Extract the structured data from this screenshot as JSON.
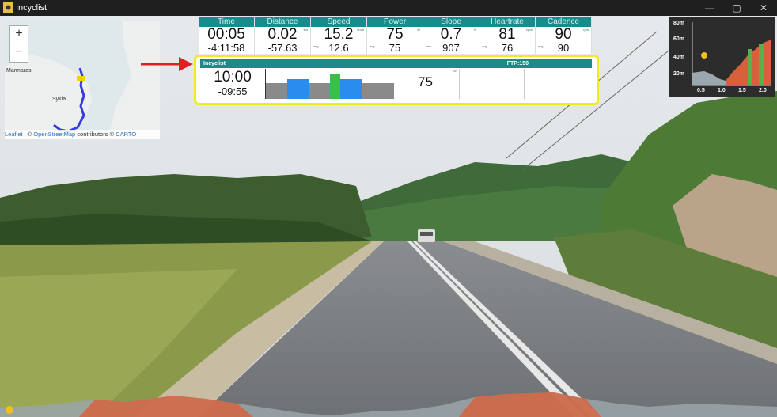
{
  "window": {
    "title": "Incyclist",
    "buttons": {
      "minimize": "—",
      "maximize": "▢",
      "close": "✕"
    }
  },
  "map": {
    "zoom_in": "+",
    "zoom_out": "−",
    "places": [
      "Marmaras",
      "Sykia"
    ],
    "attribution": {
      "leaflet": "Leaflet",
      "sep1": " | © ",
      "osm": "OpenStreetMap",
      "contrib": " contributors © ",
      "carto": "CARTO"
    }
  },
  "stats": [
    {
      "label": "Time",
      "value": "00:05",
      "unit": "",
      "avg_label": "",
      "avg": "-4:11:58"
    },
    {
      "label": "Distance",
      "value": "0.02",
      "unit": "km",
      "avg_label": "",
      "avg": "-57.63"
    },
    {
      "label": "Speed",
      "value": "15.2",
      "unit": "km/h",
      "avg_label": "avg",
      "avg": "12.6"
    },
    {
      "label": "Power",
      "value": "75",
      "unit": "W",
      "avg_label": "avg",
      "avg": "75"
    },
    {
      "label": "Slope",
      "value": "0.7",
      "unit": "%",
      "avg_label": "elev.",
      "avg": "907"
    },
    {
      "label": "Heartrate",
      "value": "81",
      "unit": "bpm",
      "avg_label": "avg",
      "avg": "76"
    },
    {
      "label": "Cadence",
      "value": "90",
      "unit": "rpm",
      "avg_label": "avg",
      "avg": "90"
    }
  ],
  "workout": {
    "name": "Incyclist",
    "ftp": "FTP:150",
    "time": "10:00",
    "remaining": "-09:55",
    "power": "75",
    "power_unit": "W"
  },
  "elevation": {
    "y_labels": [
      "80m",
      "60m",
      "40m",
      "20m"
    ],
    "x_labels": [
      "0.5",
      "1.0",
      "1.5",
      "2.0"
    ]
  },
  "colors": {
    "header_teal": "#1b8a8a",
    "highlight_yellow": "#f3ea1e",
    "arrow_red": "#e02020",
    "bar_blue": "#2b8cf0",
    "bar_green": "#3cbf4a",
    "bar_gray": "#8a8a8a"
  }
}
